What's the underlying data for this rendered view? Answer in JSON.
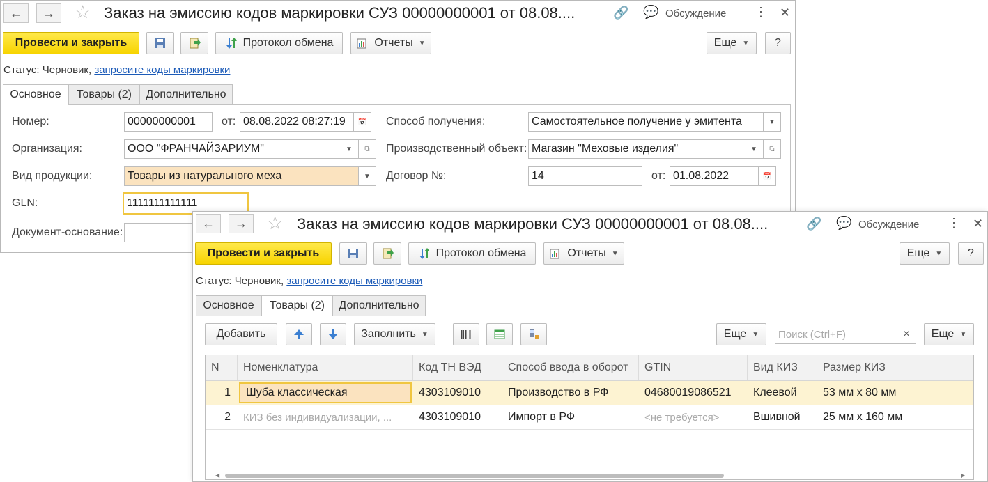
{
  "window": {
    "title": "Заказ на эмиссию кодов маркировки СУЗ 00000000001 от 08.08....",
    "discussion": "Обсуждение",
    "post_close": "Провести и закрыть",
    "protocol": "Протокол обмена",
    "reports": "Отчеты",
    "more": "Еще",
    "help": "?"
  },
  "status": {
    "label": "Статус:",
    "value": "Черновик,",
    "link": "запросите коды маркировки"
  },
  "tabs": [
    "Основное",
    "Товары (2)",
    "Дополнительно"
  ],
  "main_form": {
    "number_label": "Номер:",
    "number_value": "00000000001",
    "from_label": "от:",
    "date_value": "08.08.2022  08:27:19",
    "org_label": "Организация:",
    "org_value": "ООО \"ФРАНЧАЙЗАРИУМ\"",
    "product_type_label": "Вид продукции:",
    "product_type_value": "Товары из натурального меха",
    "gln_label": "GLN:",
    "gln_value": "1111111111111",
    "base_doc_label": "Документ-основание:",
    "method_label": "Способ получения:",
    "method_value": "Самостоятельное получение у эмитента",
    "prod_obj_label": "Производственный объект:",
    "prod_obj_value": "Магазин \"Меховые изделия\"",
    "contract_label": "Договор №:",
    "contract_value": "14",
    "contract_from_label": "от:",
    "contract_date": "01.08.2022"
  },
  "goods_toolbar": {
    "add": "Добавить",
    "fill": "Заполнить",
    "more1": "Еще",
    "search_placeholder": "Поиск (Ctrl+F)",
    "clear": "×",
    "more2": "Еще"
  },
  "grid": {
    "columns": [
      "N",
      "Номенклатура",
      "Код ТН ВЭД",
      "Способ ввода в оборот",
      "GTIN",
      "Вид КИЗ",
      "Размер КИЗ"
    ],
    "rows": [
      {
        "n": "1",
        "item": "Шуба классическая",
        "code": "4303109010",
        "method": "Производство в РФ",
        "gtin": "04680019086521",
        "kiz_type": "Клеевой",
        "kiz_size": "53 мм х 80 мм"
      },
      {
        "n": "2",
        "item": "КИЗ без индивидуализации, ...",
        "code": "4303109010",
        "method": "Импорт в РФ",
        "gtin": "<не требуется>",
        "kiz_type": "Вшивной",
        "kiz_size": "25 мм х 160 мм"
      }
    ]
  },
  "colors": {
    "primary_button": "#f7d400",
    "link": "#1c5bb8",
    "selected_row": "#fdf3d2",
    "yellow_field": "#fbe3bf"
  }
}
